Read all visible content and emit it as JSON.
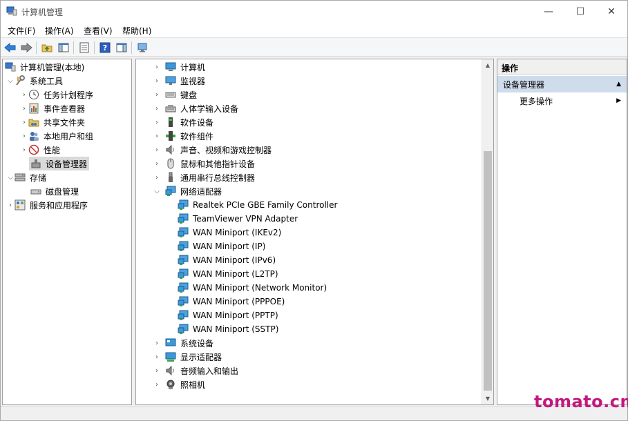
{
  "window": {
    "title": "计算机管理",
    "min_glyph": "—",
    "max_glyph": "☐",
    "close_glyph": "✕"
  },
  "menu": {
    "file": "文件(F)",
    "action": "操作(A)",
    "view": "查看(V)",
    "help": "帮助(H)"
  },
  "tree": {
    "root": "计算机管理(本地)",
    "system_tools": "系统工具",
    "task_scheduler": "任务计划程序",
    "event_viewer": "事件查看器",
    "shared_folders": "共享文件夹",
    "local_users": "本地用户和组",
    "performance": "性能",
    "device_manager": "设备管理器",
    "storage": "存储",
    "disk_management": "磁盘管理",
    "services_apps": "服务和应用程序"
  },
  "devices": {
    "computer": "计算机",
    "monitors": "监视器",
    "keyboards": "键盘",
    "hid": "人体学输入设备",
    "software_devices": "软件设备",
    "software_components": "软件组件",
    "sound": "声音、视频和游戏控制器",
    "mice": "鼠标和其他指针设备",
    "usb": "通用串行总线控制器",
    "network_adapters": "网络适配器",
    "adapters": [
      "Realtek PCIe GBE Family Controller",
      "TeamViewer VPN Adapter",
      "WAN Miniport (IKEv2)",
      "WAN Miniport (IP)",
      "WAN Miniport (IPv6)",
      "WAN Miniport (L2TP)",
      "WAN Miniport (Network Monitor)",
      "WAN Miniport (PPPOE)",
      "WAN Miniport (PPTP)",
      "WAN Miniport (SSTP)"
    ],
    "system_devices": "系统设备",
    "display_adapters": "显示适配器",
    "audio_io": "音频输入和输出",
    "cameras": "照相机"
  },
  "actions": {
    "header": "操作",
    "section": "设备管理器",
    "more": "更多操作"
  },
  "watermark": "tomato.cm"
}
